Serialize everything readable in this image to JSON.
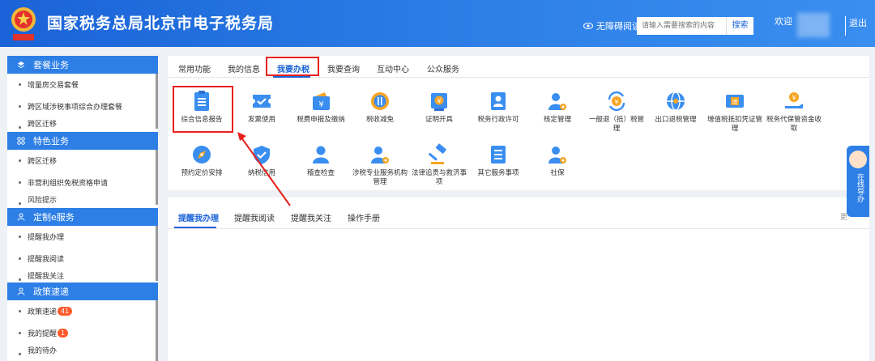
{
  "header": {
    "title": "国家税务总局北京市电子税务局",
    "accessibility": "无障碍阅读",
    "search_placeholder": "请输入需要搜索的内容",
    "search_button": "搜索",
    "welcome": "欢迎",
    "logout": "退出",
    "bar_color": "#1a63d8"
  },
  "sidebar": {
    "groups": [
      {
        "title": "套餐业务",
        "icon": "layers-icon",
        "items": [
          "增量房交易套餐",
          "跨区域涉税事项综合办理套餐",
          "跨区迁移"
        ]
      },
      {
        "title": "特色业务",
        "icon": "grid-icon",
        "items": [
          "跨区迁移",
          "非营利组织免税资格申请",
          "风险提示"
        ]
      },
      {
        "title": "定制e服务",
        "icon": "user-icon",
        "items": [
          "提醒我办理",
          "提醒我阅读",
          "提醒我关注"
        ]
      },
      {
        "title": "政策速递",
        "icon": "user-icon",
        "items": [
          "政策速递",
          "我的提醒",
          "我的待办"
        ],
        "badges": [
          "41",
          "1"
        ]
      }
    ]
  },
  "main": {
    "tabs": [
      "常用功能",
      "我的信息",
      "我要办税",
      "我要查询",
      "互动中心",
      "公众服务"
    ],
    "active_tab": "我要办税",
    "items": [
      {
        "label": "综合信息报告",
        "icon": "clipboard-icon"
      },
      {
        "label": "发票使用",
        "icon": "ticket-icon"
      },
      {
        "label": "税费申报及缴纳",
        "icon": "wallet-icon"
      },
      {
        "label": "税收减免",
        "icon": "coins-icon"
      },
      {
        "label": "证明开具",
        "icon": "certificate-icon"
      },
      {
        "label": "税务行政许可",
        "icon": "id-card-icon"
      },
      {
        "label": "核定管理",
        "icon": "person-gear-icon"
      },
      {
        "label": "一般退（抵）税管理",
        "icon": "refund-cycle-icon"
      },
      {
        "label": "出口退税管理",
        "icon": "globe-icon"
      },
      {
        "label": "增值税抵扣凭证管理",
        "icon": "voucher-icon"
      },
      {
        "label": "税务代保管资金收取",
        "icon": "money-hand-icon"
      },
      {
        "label": "预约定价安排",
        "icon": "compass-icon"
      },
      {
        "label": "纳税信用",
        "icon": "shield-check-icon"
      },
      {
        "label": "稽查检查",
        "icon": "inspector-icon"
      },
      {
        "label": "涉税专业服务机构管理",
        "icon": "agent-gear-icon"
      },
      {
        "label": "法律追责与救济事项",
        "icon": "gavel-icon"
      },
      {
        "label": "其它服务事项",
        "icon": "list-doc-icon"
      },
      {
        "label": "社保",
        "icon": "person-gear-icon"
      }
    ]
  },
  "reminder": {
    "tabs": [
      "提醒我办理",
      "提醒我阅读",
      "提醒我关注",
      "操作手册"
    ],
    "active_tab": "提醒我办理",
    "more": "更"
  },
  "guide": {
    "text": "在线导办"
  },
  "colors": {
    "primary": "#1a63d8",
    "highlight": "#e8201d",
    "icon_blue": "#3a8ef0",
    "icon_orange": "#f5a524"
  }
}
